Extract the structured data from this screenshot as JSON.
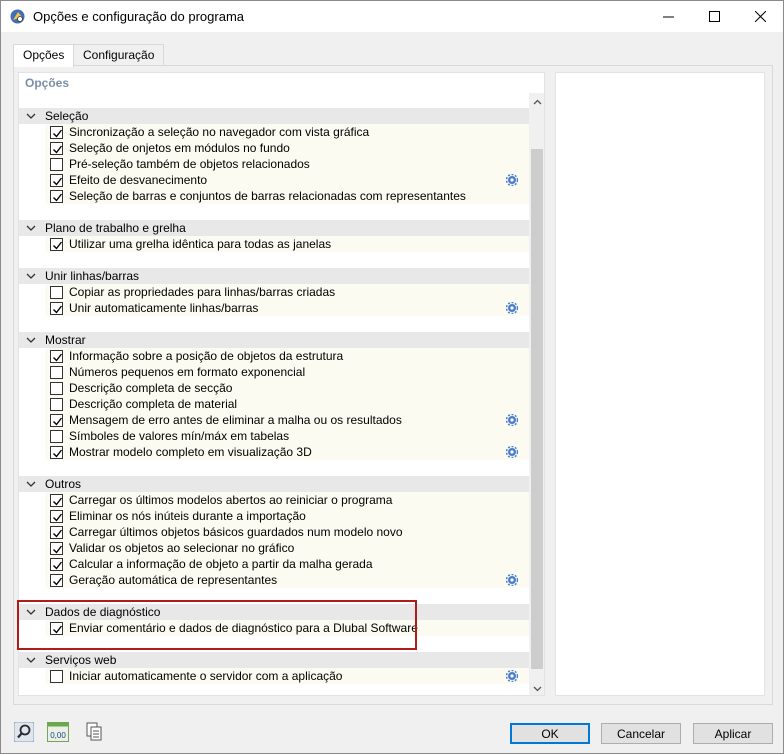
{
  "window": {
    "title": "Opções e configuração do programa",
    "controls": [
      "minimize",
      "maximize",
      "close"
    ]
  },
  "tabs": [
    {
      "label": "Opções",
      "active": true
    },
    {
      "label": "Configuração",
      "active": false
    }
  ],
  "left_pane": {
    "header": "Opções",
    "sections": [
      {
        "label": "Seleção",
        "items": [
          {
            "label": "Sincronização a seleção no navegador com vista gráfica",
            "checked": true,
            "gear": false
          },
          {
            "label": "Seleção de onjetos em módulos no fundo",
            "checked": true,
            "gear": false
          },
          {
            "label": "Pré-seleção também de objetos relacionados",
            "checked": false,
            "gear": false
          },
          {
            "label": "Efeito de desvanecimento",
            "checked": true,
            "gear": true
          },
          {
            "label": "Seleção de barras e conjuntos de barras relacionadas com representantes",
            "checked": true,
            "gear": false
          }
        ]
      },
      {
        "label": "Plano de trabalho e grelha",
        "items": [
          {
            "label": "Utilizar uma grelha idêntica para todas as janelas",
            "checked": true,
            "gear": false
          }
        ]
      },
      {
        "label": "Unir linhas/barras",
        "items": [
          {
            "label": "Copiar as propriedades para linhas/barras criadas",
            "checked": false,
            "gear": false
          },
          {
            "label": "Unir automaticamente linhas/barras",
            "checked": true,
            "gear": true
          }
        ]
      },
      {
        "label": "Mostrar",
        "items": [
          {
            "label": "Informação sobre a posição de objetos da estrutura",
            "checked": true,
            "gear": false
          },
          {
            "label": "Números pequenos em formato exponencial",
            "checked": false,
            "gear": false
          },
          {
            "label": "Descrição completa de secção",
            "checked": false,
            "gear": false
          },
          {
            "label": "Descrição completa de material",
            "checked": false,
            "gear": false
          },
          {
            "label": "Mensagem de erro antes de eliminar a malha ou os resultados",
            "checked": true,
            "gear": true
          },
          {
            "label": "Símboles de valores mín/máx em tabelas",
            "checked": false,
            "gear": false
          },
          {
            "label": "Mostrar modelo completo em visualização 3D",
            "checked": true,
            "gear": true
          }
        ]
      },
      {
        "label": "Outros",
        "items": [
          {
            "label": "Carregar os últimos modelos abertos ao reiniciar o programa",
            "checked": true,
            "gear": false
          },
          {
            "label": "Eliminar os nós inúteis durante a importação",
            "checked": true,
            "gear": false
          },
          {
            "label": "Carregar últimos objetos básicos guardados num modelo novo",
            "checked": true,
            "gear": false
          },
          {
            "label": "Validar os objetos ao selecionar no gráfico",
            "checked": true,
            "gear": false
          },
          {
            "label": "Calcular a informação de objeto a partir da malha gerada",
            "checked": true,
            "gear": false
          },
          {
            "label": "Geração automática de representantes",
            "checked": true,
            "gear": true
          }
        ]
      },
      {
        "label": "Dados de diagnóstico",
        "items": [
          {
            "label": "Enviar comentário e dados de diagnóstico para a Dlubal Software",
            "checked": true,
            "gear": false
          }
        ]
      },
      {
        "label": "Serviços web",
        "items": [
          {
            "label": "Iniciar automaticamente o servidor com a aplicação",
            "checked": false,
            "gear": true
          }
        ]
      }
    ]
  },
  "footer": {
    "icons": [
      "search-icon",
      "units-icon",
      "copy-icon"
    ],
    "units_icon_text": "0,00",
    "buttons": {
      "ok": "OK",
      "cancel": "Cancelar",
      "apply": "Aplicar"
    }
  },
  "colors": {
    "highlight": "#b31b1b",
    "checkmark": "#000000",
    "gear": "#4a7cc9",
    "section_header": "#e8e8e8",
    "section_body": "#fbfbf1",
    "header_text": "#7a8fa8"
  }
}
